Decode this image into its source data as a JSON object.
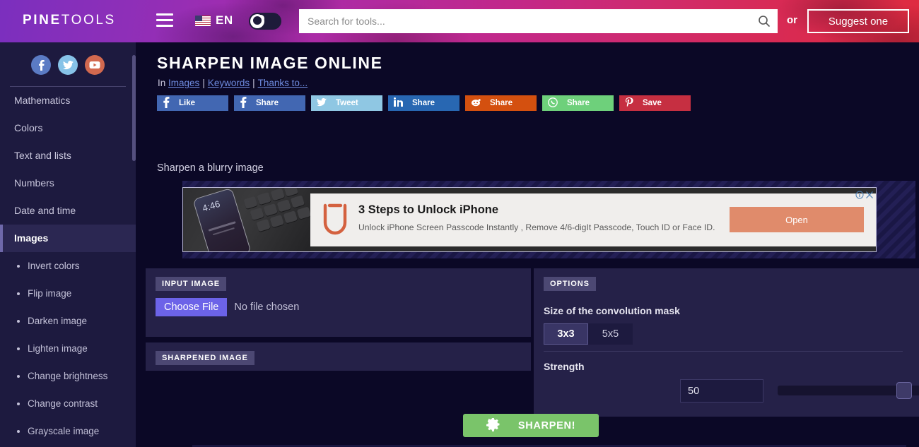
{
  "header": {
    "logo_bold": "PINE",
    "logo_light": "TOOLS",
    "menu_icon": "hamburger-icon",
    "language": "EN",
    "flag_icon": "us-flag-icon",
    "theme_toggle_icon": "moon-icon",
    "search": {
      "value": "",
      "placeholder": "Search for tools..."
    },
    "search_icon": "search-icon",
    "or_label": "or",
    "suggest_label": "Suggest one"
  },
  "sidebar": {
    "socials": [
      {
        "name": "facebook-icon",
        "label": "f"
      },
      {
        "name": "twitter-icon",
        "label": "t"
      },
      {
        "name": "youtube-icon",
        "label": "y"
      }
    ],
    "categories": [
      {
        "label": "Mathematics",
        "active": false
      },
      {
        "label": "Colors",
        "active": false
      },
      {
        "label": "Text and lists",
        "active": false
      },
      {
        "label": "Numbers",
        "active": false
      },
      {
        "label": "Date and time",
        "active": false
      },
      {
        "label": "Images",
        "active": true
      }
    ],
    "subitems": [
      {
        "label": "Invert colors"
      },
      {
        "label": "Flip image"
      },
      {
        "label": "Darken image"
      },
      {
        "label": "Lighten image"
      },
      {
        "label": "Change brightness"
      },
      {
        "label": "Change contrast"
      },
      {
        "label": "Grayscale image"
      }
    ]
  },
  "main": {
    "title": "SHARPEN IMAGE ONLINE",
    "breadcrumb": {
      "prefix": "In",
      "link1": "Images",
      "link2": "Keywords",
      "link3": "Thanks to..."
    },
    "share_buttons": [
      {
        "network": "facebook-like",
        "label": "Like"
      },
      {
        "network": "facebook-share",
        "label": "Share"
      },
      {
        "network": "twitter",
        "label": "Tweet"
      },
      {
        "network": "linkedin",
        "label": "Share"
      },
      {
        "network": "reddit",
        "label": "Share"
      },
      {
        "network": "whatsapp",
        "label": "Share"
      },
      {
        "network": "pinterest",
        "label": "Save"
      }
    ],
    "subtitle": "Sharpen a blurry image"
  },
  "ad": {
    "title": "3 Steps to Unlock iPhone",
    "description": "Unlock iPhone Screen Passcode Instantly , Remove 4/6-digIt Passcode, Touch ID or Face ID.",
    "cta": "Open",
    "phone_time": "4:46",
    "info_icon": "adchoices-info-icon",
    "close_icon": "close-icon"
  },
  "panels": {
    "input_badge": "INPUT IMAGE",
    "choose_file_label": "Choose File",
    "no_file_label": "No file chosen",
    "output_badge": "SHARPENED IMAGE",
    "options_badge": "OPTIONS",
    "mask_label": "Size of the convolution mask",
    "mask_options": [
      {
        "label": "3x3",
        "selected": true
      },
      {
        "label": "5x5",
        "selected": false
      }
    ],
    "strength_label": "Strength",
    "strength_value": "50"
  },
  "action": {
    "sharpen_label": "SHARPEN!",
    "gear_icon": "gear-icon"
  },
  "colors": {
    "accent_green": "#7ac46a",
    "accent_purple": "#6c63e8",
    "panel_bg": "#252148",
    "page_bg": "#0b0826",
    "sidebar_bg": "#1d1a3f"
  }
}
